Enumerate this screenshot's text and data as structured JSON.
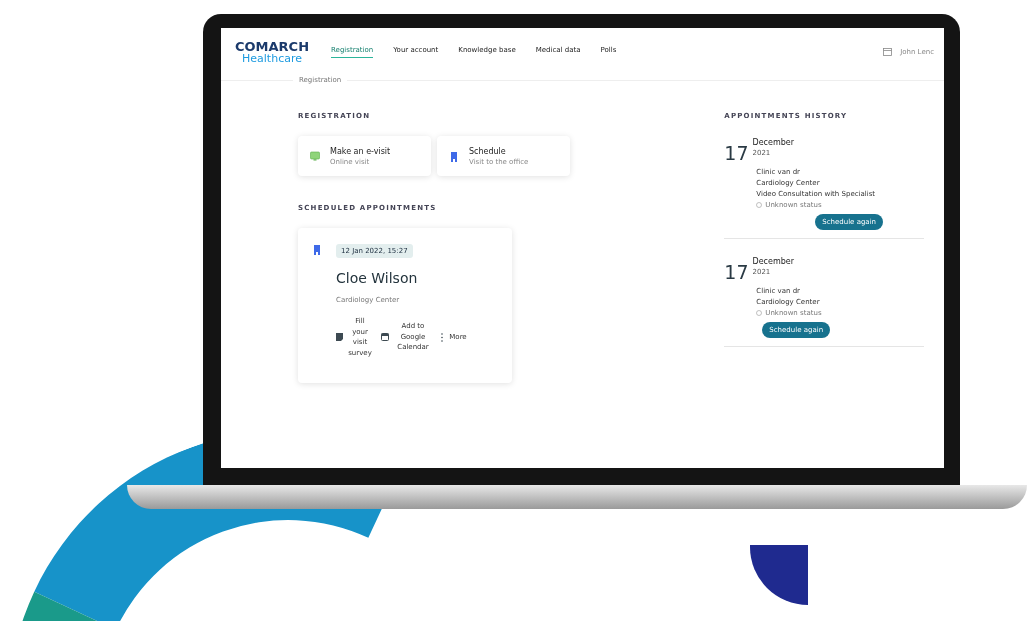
{
  "logo": {
    "name": "COMARCH",
    "product": "Healthcare"
  },
  "nav": [
    {
      "label": "Registration",
      "selected": true
    },
    {
      "label": "Your account",
      "selected": false
    },
    {
      "label": "Knowledge base",
      "selected": false
    },
    {
      "label": "Medical data",
      "selected": false
    },
    {
      "label": "Polls",
      "selected": false
    }
  ],
  "user": {
    "name": "John Lenc"
  },
  "breadcrumb": "Registration",
  "registration": {
    "title": "REGISTRATION",
    "options": [
      {
        "kind": "evisit",
        "title": "Make an e-visit",
        "subtitle": "Online visit"
      },
      {
        "kind": "office",
        "title": "Schedule",
        "subtitle": "Visit to the office"
      }
    ]
  },
  "scheduled": {
    "title": "SCHEDULED APPOINTMENTS",
    "appointment": {
      "date": "12 Jan 2022, 15:27",
      "doctor": "Cloe Wilson",
      "place": "Cardiology Center",
      "actions": [
        {
          "kind": "survey",
          "label": "Fill your visit survey"
        },
        {
          "kind": "calendar",
          "label": "Add to Google Calendar"
        },
        {
          "kind": "more",
          "label": "More"
        }
      ]
    }
  },
  "history": {
    "title": "APPOINTMENTS HISTORY",
    "items": [
      {
        "day": "17",
        "month": "December",
        "year": "2021",
        "lines": [
          "Clinic van dr",
          "Cardiology Center",
          "Video Consultation with Specialist"
        ],
        "status": "Unknown status",
        "button": "Schedule again"
      },
      {
        "day": "17",
        "month": "December",
        "year": "2021",
        "lines": [
          "Clinic van dr",
          "Cardiology Center"
        ],
        "status": "Unknown status",
        "button": "Schedule again"
      }
    ]
  }
}
